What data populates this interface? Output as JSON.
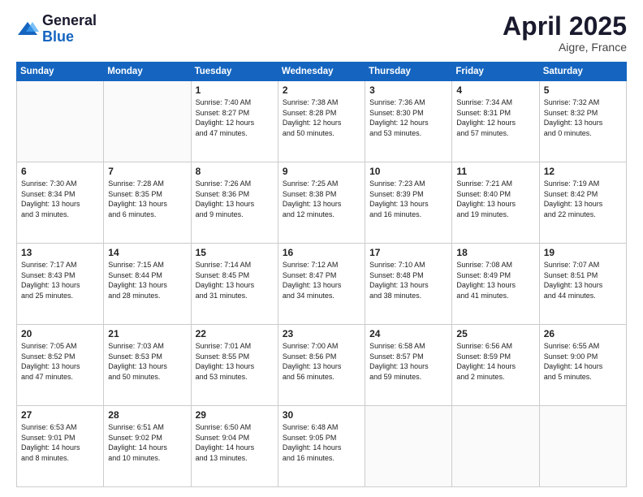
{
  "logo": {
    "line1": "General",
    "line2": "Blue"
  },
  "title": "April 2025",
  "location": "Aigre, France",
  "days_header": [
    "Sunday",
    "Monday",
    "Tuesday",
    "Wednesday",
    "Thursday",
    "Friday",
    "Saturday"
  ],
  "weeks": [
    [
      {
        "num": "",
        "info": ""
      },
      {
        "num": "",
        "info": ""
      },
      {
        "num": "1",
        "info": "Sunrise: 7:40 AM\nSunset: 8:27 PM\nDaylight: 12 hours\nand 47 minutes."
      },
      {
        "num": "2",
        "info": "Sunrise: 7:38 AM\nSunset: 8:28 PM\nDaylight: 12 hours\nand 50 minutes."
      },
      {
        "num": "3",
        "info": "Sunrise: 7:36 AM\nSunset: 8:30 PM\nDaylight: 12 hours\nand 53 minutes."
      },
      {
        "num": "4",
        "info": "Sunrise: 7:34 AM\nSunset: 8:31 PM\nDaylight: 12 hours\nand 57 minutes."
      },
      {
        "num": "5",
        "info": "Sunrise: 7:32 AM\nSunset: 8:32 PM\nDaylight: 13 hours\nand 0 minutes."
      }
    ],
    [
      {
        "num": "6",
        "info": "Sunrise: 7:30 AM\nSunset: 8:34 PM\nDaylight: 13 hours\nand 3 minutes."
      },
      {
        "num": "7",
        "info": "Sunrise: 7:28 AM\nSunset: 8:35 PM\nDaylight: 13 hours\nand 6 minutes."
      },
      {
        "num": "8",
        "info": "Sunrise: 7:26 AM\nSunset: 8:36 PM\nDaylight: 13 hours\nand 9 minutes."
      },
      {
        "num": "9",
        "info": "Sunrise: 7:25 AM\nSunset: 8:38 PM\nDaylight: 13 hours\nand 12 minutes."
      },
      {
        "num": "10",
        "info": "Sunrise: 7:23 AM\nSunset: 8:39 PM\nDaylight: 13 hours\nand 16 minutes."
      },
      {
        "num": "11",
        "info": "Sunrise: 7:21 AM\nSunset: 8:40 PM\nDaylight: 13 hours\nand 19 minutes."
      },
      {
        "num": "12",
        "info": "Sunrise: 7:19 AM\nSunset: 8:42 PM\nDaylight: 13 hours\nand 22 minutes."
      }
    ],
    [
      {
        "num": "13",
        "info": "Sunrise: 7:17 AM\nSunset: 8:43 PM\nDaylight: 13 hours\nand 25 minutes."
      },
      {
        "num": "14",
        "info": "Sunrise: 7:15 AM\nSunset: 8:44 PM\nDaylight: 13 hours\nand 28 minutes."
      },
      {
        "num": "15",
        "info": "Sunrise: 7:14 AM\nSunset: 8:45 PM\nDaylight: 13 hours\nand 31 minutes."
      },
      {
        "num": "16",
        "info": "Sunrise: 7:12 AM\nSunset: 8:47 PM\nDaylight: 13 hours\nand 34 minutes."
      },
      {
        "num": "17",
        "info": "Sunrise: 7:10 AM\nSunset: 8:48 PM\nDaylight: 13 hours\nand 38 minutes."
      },
      {
        "num": "18",
        "info": "Sunrise: 7:08 AM\nSunset: 8:49 PM\nDaylight: 13 hours\nand 41 minutes."
      },
      {
        "num": "19",
        "info": "Sunrise: 7:07 AM\nSunset: 8:51 PM\nDaylight: 13 hours\nand 44 minutes."
      }
    ],
    [
      {
        "num": "20",
        "info": "Sunrise: 7:05 AM\nSunset: 8:52 PM\nDaylight: 13 hours\nand 47 minutes."
      },
      {
        "num": "21",
        "info": "Sunrise: 7:03 AM\nSunset: 8:53 PM\nDaylight: 13 hours\nand 50 minutes."
      },
      {
        "num": "22",
        "info": "Sunrise: 7:01 AM\nSunset: 8:55 PM\nDaylight: 13 hours\nand 53 minutes."
      },
      {
        "num": "23",
        "info": "Sunrise: 7:00 AM\nSunset: 8:56 PM\nDaylight: 13 hours\nand 56 minutes."
      },
      {
        "num": "24",
        "info": "Sunrise: 6:58 AM\nSunset: 8:57 PM\nDaylight: 13 hours\nand 59 minutes."
      },
      {
        "num": "25",
        "info": "Sunrise: 6:56 AM\nSunset: 8:59 PM\nDaylight: 14 hours\nand 2 minutes."
      },
      {
        "num": "26",
        "info": "Sunrise: 6:55 AM\nSunset: 9:00 PM\nDaylight: 14 hours\nand 5 minutes."
      }
    ],
    [
      {
        "num": "27",
        "info": "Sunrise: 6:53 AM\nSunset: 9:01 PM\nDaylight: 14 hours\nand 8 minutes."
      },
      {
        "num": "28",
        "info": "Sunrise: 6:51 AM\nSunset: 9:02 PM\nDaylight: 14 hours\nand 10 minutes."
      },
      {
        "num": "29",
        "info": "Sunrise: 6:50 AM\nSunset: 9:04 PM\nDaylight: 14 hours\nand 13 minutes."
      },
      {
        "num": "30",
        "info": "Sunrise: 6:48 AM\nSunset: 9:05 PM\nDaylight: 14 hours\nand 16 minutes."
      },
      {
        "num": "",
        "info": ""
      },
      {
        "num": "",
        "info": ""
      },
      {
        "num": "",
        "info": ""
      }
    ]
  ]
}
